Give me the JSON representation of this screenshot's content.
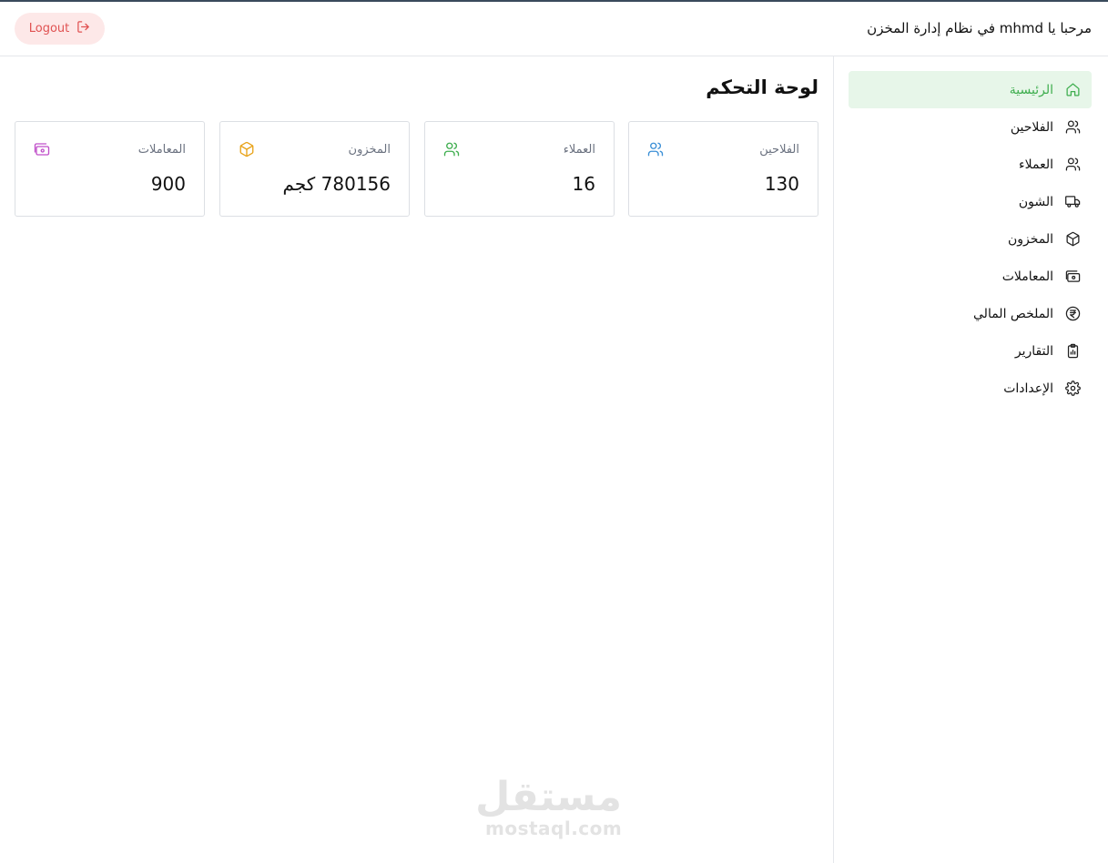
{
  "header": {
    "welcome": "مرحبا يا mhmd في نظام إدارة المخزن",
    "logout_label": "Logout"
  },
  "sidebar": {
    "items": [
      {
        "label": "الرئيسية",
        "icon": "home-icon",
        "active": true
      },
      {
        "label": "الفلاحين",
        "icon": "users-icon"
      },
      {
        "label": "العملاء",
        "icon": "users-icon"
      },
      {
        "label": "الشون",
        "icon": "truck-icon"
      },
      {
        "label": "المخزون",
        "icon": "box-icon"
      },
      {
        "label": "المعاملات",
        "icon": "wallet-icon"
      },
      {
        "label": "الملخص المالي",
        "icon": "rupee-icon"
      },
      {
        "label": "التقارير",
        "icon": "clipboard-chart-icon"
      },
      {
        "label": "الإعدادات",
        "icon": "gear-icon"
      }
    ]
  },
  "main": {
    "title": "لوحة التحكم",
    "cards": [
      {
        "label": "الفلاحين",
        "value": "130",
        "icon": "users-icon",
        "color": "#3b8fd6"
      },
      {
        "label": "العملاء",
        "value": "16",
        "icon": "users-icon",
        "color": "#3fae4f"
      },
      {
        "label": "المخزون",
        "value": "780156 كجم",
        "icon": "box-icon",
        "color": "#e8a31a"
      },
      {
        "label": "المعاملات",
        "value": "900",
        "icon": "wallet-icon",
        "color": "#c04fc9"
      }
    ]
  },
  "colors": {
    "accent": "#3fae4f",
    "active_bg": "#e7f6e9",
    "logout_bg": "#fde8e8",
    "logout_text": "#e05252"
  },
  "watermark": {
    "arabic": "مستقل",
    "latin": "mostaql.com"
  }
}
